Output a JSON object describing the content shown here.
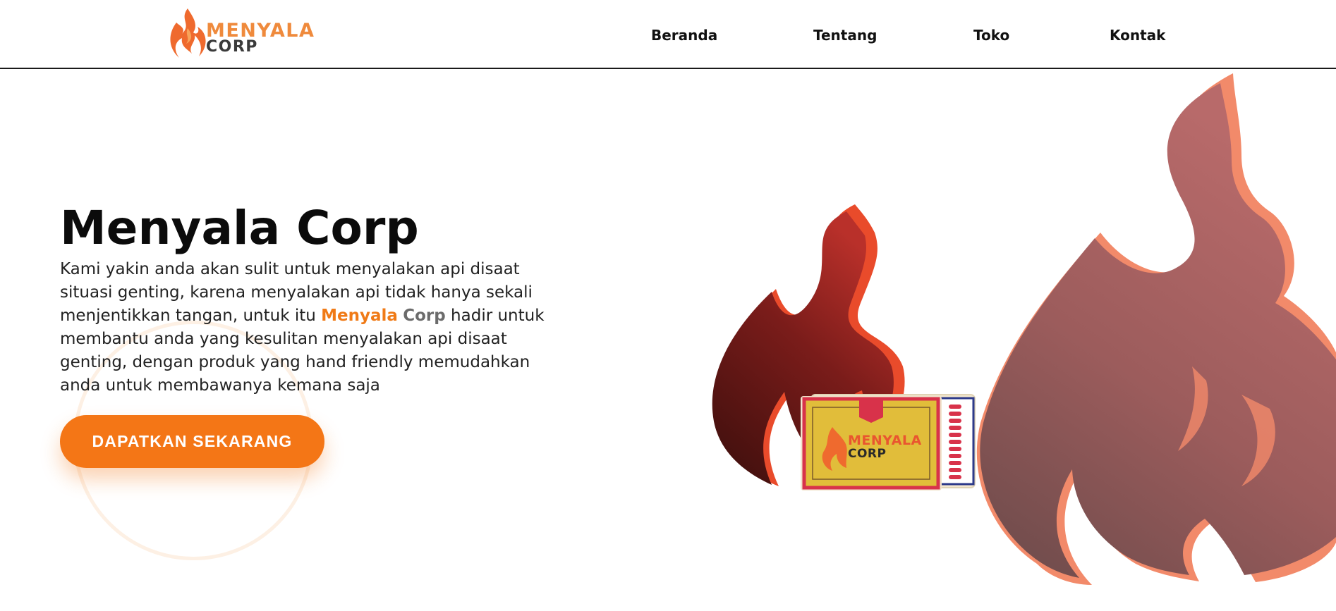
{
  "brand": {
    "name_line1": "MENYALA",
    "name_line2": "CORP",
    "logo_icon": "flame-icon",
    "colors": {
      "orange": "#f07a16",
      "dark": "#3a3a3a",
      "flame_red": "#e9562f"
    }
  },
  "nav": {
    "items": [
      {
        "label": "Beranda"
      },
      {
        "label": "Tentang"
      },
      {
        "label": "Toko"
      },
      {
        "label": "Kontak"
      }
    ]
  },
  "hero": {
    "title": "Menyala Corp",
    "description": {
      "line1": "Kami yakin anda akan sulit untuk menyalakan api disaat",
      "line2": "situasi genting, karena menyalakan api tidak hanya sekali",
      "line3_before": "menjentikkan tangan, untuk itu ",
      "line3_highlight_1": "Menyala",
      "line3_highlight_2": "Corp",
      "line3_after": " hadir untuk",
      "line4": "membantu anda yang kesulitan menyalakan api disaat",
      "line5": "genting, dengan produk yang hand friendly memudahkan",
      "line6": "anda untuk membawanya kemana saja"
    },
    "cta_label": "DAPATKAN SEKARANG"
  },
  "illustration": {
    "description_icon": "fire-illustration",
    "matchbox_brand_line1": "MENYALA",
    "matchbox_brand_line2": "CORP"
  }
}
